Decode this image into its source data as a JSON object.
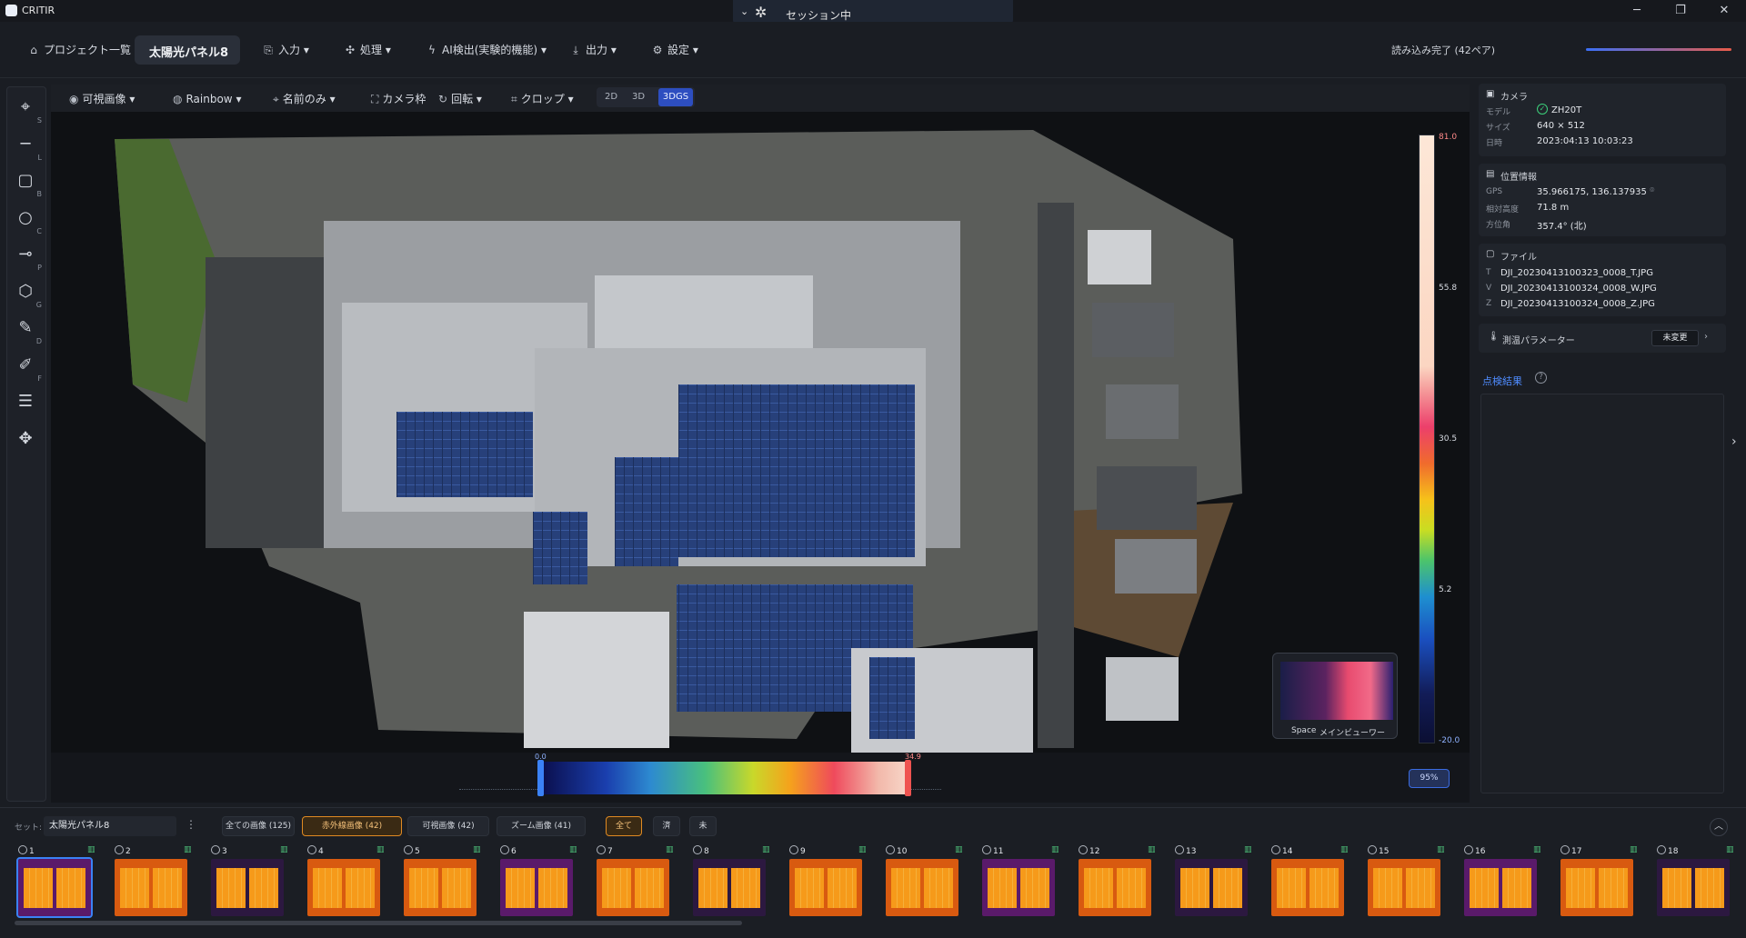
{
  "app": {
    "title": "CRITIR",
    "session": "セッション中"
  },
  "menu": {
    "project_list": "プロジェクト一覧",
    "project_name": "太陽光パネル8",
    "input": "入力",
    "process": "処理",
    "ai": "AI検出(実験的機能)",
    "output": "出力",
    "settings": "設定",
    "load_status": "読み込み完了 (42ペア)"
  },
  "toolbar": {
    "visible_image": "可視画像",
    "palette": "Rainbow",
    "name_only": "名前のみ",
    "camera_frame": "カメラ枠",
    "rotate": "回転",
    "crop": "クロップ",
    "mode_2d": "2D",
    "mode_3d": "3D",
    "mode_3dgs": "3DGS"
  },
  "left_tools": [
    {
      "name": "crosshair-icon",
      "key": "S"
    },
    {
      "name": "line-icon",
      "key": "L"
    },
    {
      "name": "square-icon",
      "key": "B"
    },
    {
      "name": "circle-icon",
      "key": "C"
    },
    {
      "name": "point-icon",
      "key": "P"
    },
    {
      "name": "polygon-icon",
      "key": "G"
    },
    {
      "name": "pen-icon",
      "key": "D"
    },
    {
      "name": "edit-icon",
      "key": "F"
    },
    {
      "name": "sliders-icon",
      "key": ""
    },
    {
      "name": "move-icon",
      "key": ""
    }
  ],
  "legend": {
    "max": "81.0",
    "t1": "55.8",
    "t2": "30.5",
    "t3": "5.2",
    "min": "-20.0"
  },
  "range": {
    "min": "0.0",
    "max": "34.9",
    "zoom": "95%",
    "min_frac": 0.0,
    "max_frac": 0.43
  },
  "minimap": {
    "space": "Space",
    "label": "メインビューワー"
  },
  "info": {
    "camera_title": "カメラ",
    "model_k": "モデル",
    "model_v": "ZH20T",
    "size_k": "サイズ",
    "size_v": "640 × 512",
    "date_k": "日時",
    "date_v": "2023:04:13 10:03:23",
    "loc_title": "位置情報",
    "gps_k": "GPS",
    "gps_v": "35.966175, 136.137935",
    "alt_k": "相対高度",
    "alt_v": "71.8 m",
    "dir_k": "方位角",
    "dir_v": "357.4° (北)",
    "file_title": "ファイル",
    "file_t_k": "T",
    "file_t": "DJI_20230413100323_0008_T.JPG",
    "file_v_k": "V",
    "file_v": "DJI_20230413100324_0008_W.JPG",
    "file_z_k": "Z",
    "file_z": "DJI_20230413100324_0008_Z.JPG",
    "param_title": "測温パラメーター",
    "param_btn": "未変更",
    "result_title": "点検結果"
  },
  "bottom": {
    "set_label": "セット:",
    "set_value": "太陽光パネル8",
    "all_images": "全ての画像 (125)",
    "ir_images": "赤外線画像 (42)",
    "visible_images": "可視画像 (42)",
    "zoom_images": "ズーム画像 (41)",
    "filter_all": "全て",
    "filter_done": "済",
    "filter_not": "未"
  },
  "thumbnails": [
    "1",
    "2",
    "3",
    "4",
    "5",
    "6",
    "7",
    "8",
    "9",
    "10",
    "11",
    "12",
    "13",
    "14",
    "15",
    "16",
    "17",
    "18"
  ]
}
